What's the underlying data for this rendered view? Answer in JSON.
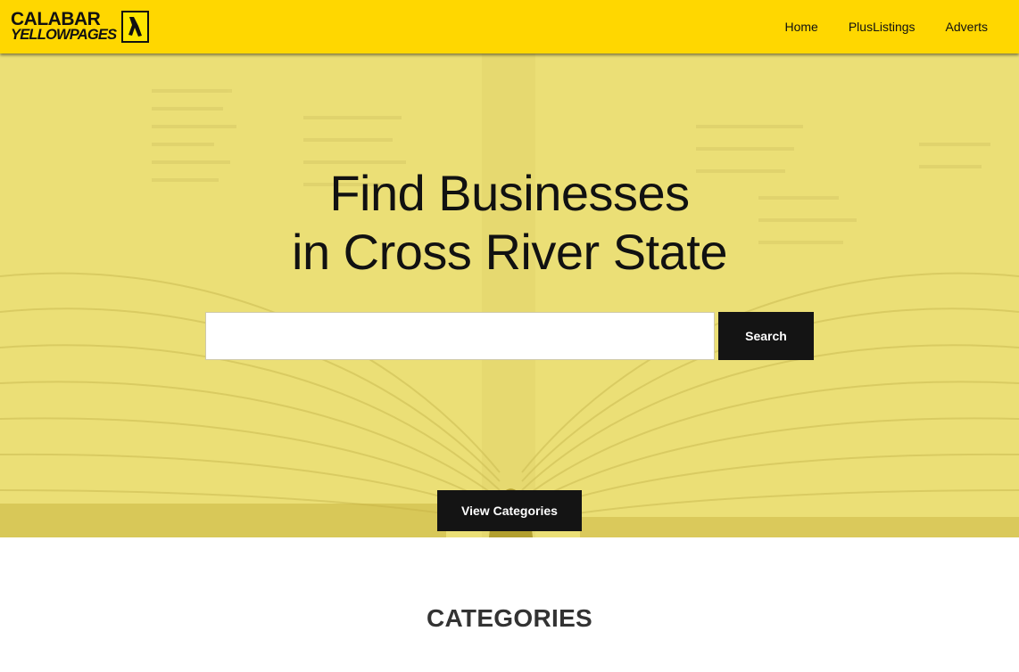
{
  "header": {
    "logo_line1": "CALABAR",
    "logo_line2": "YELLOWPAGES",
    "nav": [
      {
        "label": "Home"
      },
      {
        "label": "PlusListings"
      },
      {
        "label": "Adverts"
      }
    ]
  },
  "hero": {
    "title_line1": "Find Businesses",
    "title_line2": "in Cross River State",
    "search_value": "",
    "search_button": "Search",
    "view_categories_button": "View Categories"
  },
  "categories": {
    "heading": "CATEGORIES"
  },
  "colors": {
    "brand_yellow": "#ffd700",
    "button_dark": "#141414",
    "hero_tint": "#eadd72"
  },
  "icons": {
    "logo_mark": "walking-fingers-icon"
  }
}
